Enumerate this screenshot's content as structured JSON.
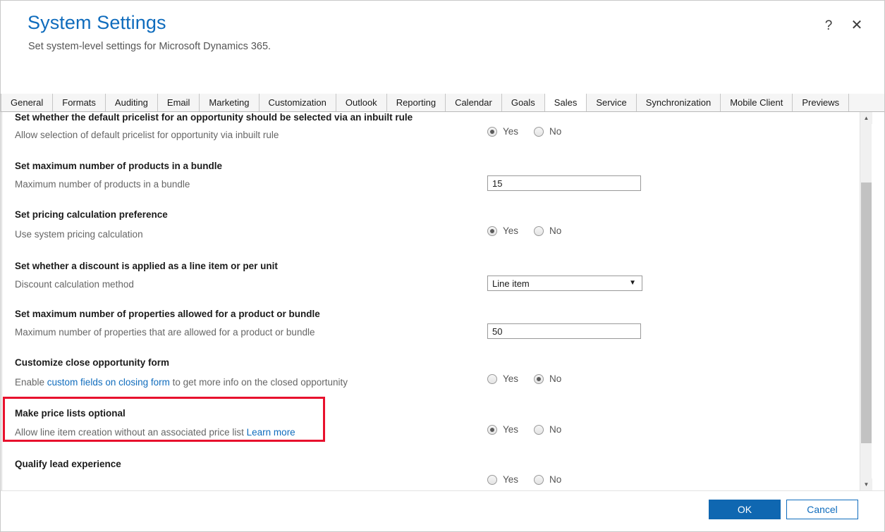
{
  "window": {
    "title": "System Settings",
    "subtitle": "Set system-level settings for Microsoft Dynamics 365.",
    "help_icon": "?",
    "close_icon": "✕"
  },
  "colors": {
    "accent_blue": "#0f6cbd",
    "primary_button": "#0f67b1",
    "highlight_red": "#e8112d",
    "heading_text": "#1b1b1b",
    "muted_text": "#666666"
  },
  "tabs": [
    {
      "label": "General",
      "active": false
    },
    {
      "label": "Formats",
      "active": false
    },
    {
      "label": "Auditing",
      "active": false
    },
    {
      "label": "Email",
      "active": false
    },
    {
      "label": "Marketing",
      "active": false
    },
    {
      "label": "Customization",
      "active": false
    },
    {
      "label": "Outlook",
      "active": false
    },
    {
      "label": "Reporting",
      "active": false
    },
    {
      "label": "Calendar",
      "active": false
    },
    {
      "label": "Goals",
      "active": false
    },
    {
      "label": "Sales",
      "active": true
    },
    {
      "label": "Service",
      "active": false
    },
    {
      "label": "Synchronization",
      "active": false
    },
    {
      "label": "Mobile Client",
      "active": false
    },
    {
      "label": "Previews",
      "active": false
    }
  ],
  "settings": [
    {
      "heading": "Set whether the default pricelist for an opportunity should be selected via an inbuilt rule",
      "description": "Allow selection of default pricelist for opportunity via inbuilt rule",
      "control": "radio",
      "yes_label": "Yes",
      "no_label": "No",
      "selected": "yes"
    },
    {
      "heading": "Set maximum number of products in a bundle",
      "description": "Maximum number of products in a bundle",
      "control": "text",
      "value": "15"
    },
    {
      "heading": "Set pricing calculation preference",
      "description": "Use system pricing calculation",
      "control": "radio",
      "yes_label": "Yes",
      "no_label": "No",
      "selected": "yes"
    },
    {
      "heading": "Set whether a discount is applied as a line item or per unit",
      "description": "Discount calculation method",
      "control": "select",
      "value": "Line item",
      "arrow": "▼"
    },
    {
      "heading": "Set maximum number of properties allowed for a product or bundle",
      "description": "Maximum number of properties that are allowed for a product or bundle",
      "control": "text",
      "value": "50"
    },
    {
      "heading": "Customize close opportunity form",
      "description_before": "Enable ",
      "description_link": "custom fields on closing form",
      "description_after": " to get more info on the closed opportunity",
      "control": "radio",
      "yes_label": "Yes",
      "no_label": "No",
      "selected": "no"
    },
    {
      "heading": "Make price lists optional",
      "description_before": "Allow line item creation without an associated price list ",
      "description_link": "Learn more",
      "description_after": "",
      "control": "radio",
      "yes_label": "Yes",
      "no_label": "No",
      "selected": "yes",
      "highlighted": true
    },
    {
      "heading": "Qualify lead experience",
      "description": "",
      "control": "radio",
      "yes_label": "Yes",
      "no_label": "No",
      "selected": "none"
    }
  ],
  "scrollbar": {
    "up_arrow": "▲",
    "down_arrow": "▼"
  },
  "footer": {
    "ok_label": "OK",
    "cancel_label": "Cancel"
  }
}
